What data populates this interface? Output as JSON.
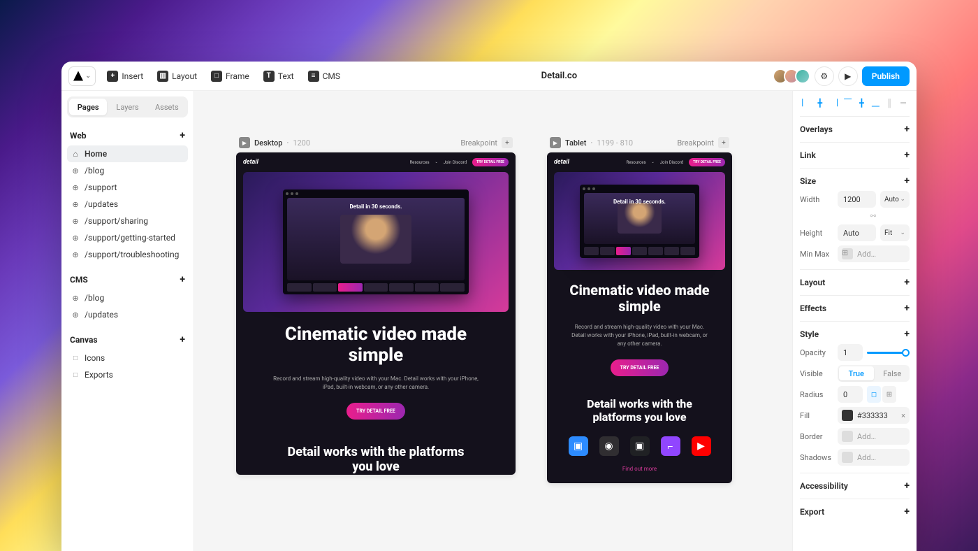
{
  "project_title": "Detail.co",
  "topbar": {
    "tools": [
      {
        "label": "Insert",
        "icon": "+"
      },
      {
        "label": "Layout",
        "icon": "▥"
      },
      {
        "label": "Frame",
        "icon": "□"
      },
      {
        "label": "Text",
        "icon": "T"
      },
      {
        "label": "CMS",
        "icon": "≡"
      }
    ],
    "publish": "Publish"
  },
  "left": {
    "tabs": [
      "Pages",
      "Layers",
      "Assets"
    ],
    "active_tab": 0,
    "sections": {
      "web": {
        "title": "Web",
        "items": [
          {
            "label": "Home",
            "icon": "home",
            "active": true
          },
          {
            "label": "/blog",
            "icon": "globe"
          },
          {
            "label": "/support",
            "icon": "globe"
          },
          {
            "label": "/updates",
            "icon": "globe"
          },
          {
            "label": "/support/sharing",
            "icon": "globe"
          },
          {
            "label": "/support/getting-started",
            "icon": "globe"
          },
          {
            "label": "/support/troubleshooting",
            "icon": "globe"
          }
        ]
      },
      "cms": {
        "title": "CMS",
        "items": [
          {
            "label": "/blog",
            "icon": "globe"
          },
          {
            "label": "/updates",
            "icon": "globe"
          }
        ]
      },
      "canvas": {
        "title": "Canvas",
        "items": [
          {
            "label": "Icons",
            "icon": "file"
          },
          {
            "label": "Exports",
            "icon": "file"
          }
        ]
      }
    }
  },
  "frames": [
    {
      "name": "Desktop",
      "dims": "1200",
      "breakpoint_label": "Breakpoint",
      "variant": "desktop"
    },
    {
      "name": "Tablet",
      "dims": "1199 - 810",
      "breakpoint_label": "Breakpoint",
      "variant": "tablet"
    }
  ],
  "mock": {
    "brand": "detail",
    "nav": {
      "resources": "Resources",
      "discord": "Join Discord",
      "cta": "TRY DETAIL FREE"
    },
    "video_title": "Detail in 30 seconds.",
    "headline": "Cinematic video made simple",
    "sub": "Record and stream high-quality video with your Mac. Detail works with your iPhone, iPad, built-in webcam, or any other camera.",
    "cta": "TRY DETAIL FREE",
    "h2": "Detail works with the platforms you love",
    "findmore": "Find out more"
  },
  "right": {
    "sections": {
      "overlays": "Overlays",
      "link": "Link",
      "size": "Size",
      "layout": "Layout",
      "effects": "Effects",
      "style": "Style",
      "accessibility": "Accessibility",
      "export": "Export"
    },
    "size": {
      "width_label": "Width",
      "width_value": "1200",
      "width_mode": "Auto",
      "height_label": "Height",
      "height_value": "Auto",
      "height_mode": "Fit",
      "minmax_label": "Min Max",
      "minmax_placeholder": "Add…"
    },
    "style": {
      "opacity_label": "Opacity",
      "opacity_value": "1",
      "visible_label": "Visible",
      "visible_true": "True",
      "visible_false": "False",
      "radius_label": "Radius",
      "radius_value": "0",
      "fill_label": "Fill",
      "fill_value": "#333333",
      "border_label": "Border",
      "border_placeholder": "Add…",
      "shadows_label": "Shadows",
      "shadows_placeholder": "Add…"
    }
  }
}
